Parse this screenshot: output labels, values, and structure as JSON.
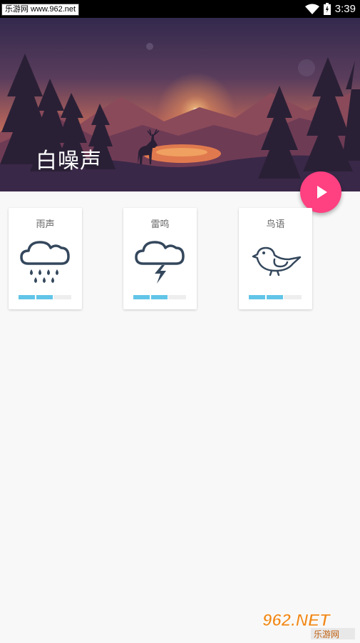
{
  "status_bar": {
    "watermark": "乐游网 www.962.net",
    "time": "3:39"
  },
  "hero": {
    "title": "白噪声"
  },
  "fab": {
    "icon": "play-icon",
    "color": "#ff4081"
  },
  "sounds": [
    {
      "label": "雨声",
      "icon": "rain-cloud-icon",
      "volume": 0.66
    },
    {
      "label": "雷鸣",
      "icon": "thunder-cloud-icon",
      "volume": 0.66
    },
    {
      "label": "鸟语",
      "icon": "bird-icon",
      "volume": 0.66
    }
  ],
  "colors": {
    "accent": "#ff4081",
    "volume": "#62c5e8",
    "icon": "#34475c"
  },
  "bottom_watermark": {
    "brand": "962.NET",
    "sub": "乐游网"
  }
}
